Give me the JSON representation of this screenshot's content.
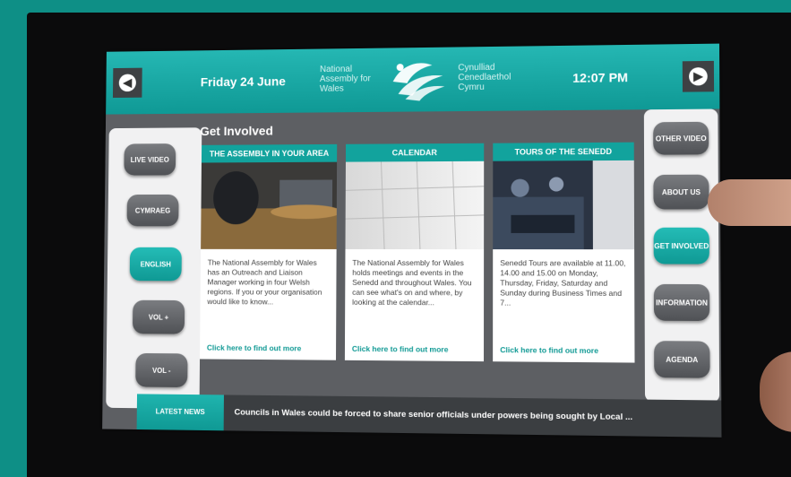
{
  "header": {
    "date": "Friday 24 June",
    "time": "12:07 PM",
    "org_en": "National Assembly for Wales",
    "org_cy": "Cynulliad Cenedlaethol Cymru"
  },
  "left_nav": [
    {
      "label": "LIVE VIDEO",
      "active": false
    },
    {
      "label": "CYMRAEG",
      "active": false
    },
    {
      "label": "ENGLISH",
      "active": true
    },
    {
      "label": "VOL +",
      "active": false
    },
    {
      "label": "VOL -",
      "active": false
    }
  ],
  "right_nav": [
    {
      "label": "OTHER VIDEO",
      "active": false
    },
    {
      "label": "ABOUT US",
      "active": false
    },
    {
      "label": "GET INVOLVED",
      "active": true
    },
    {
      "label": "INFORMATION",
      "active": false
    },
    {
      "label": "AGENDA",
      "active": false
    }
  ],
  "main": {
    "title": "Get Involved",
    "cards": [
      {
        "heading": "THE ASSEMBLY IN YOUR AREA",
        "body": "The National Assembly for Wales has an Outreach and Liaison Manager working in four Welsh regions. If you or your organisation would like to know...",
        "link": "Click here to find out more"
      },
      {
        "heading": "CALENDAR",
        "body": "The National Assembly for Wales holds meetings and events in the Senedd and throughout Wales. You can see what's on and where, by looking at the calendar...",
        "link": "Click here to find out more"
      },
      {
        "heading": "TOURS OF THE SENEDD",
        "body": "Senedd Tours are available at 11.00, 14.00 and 15.00 on Monday, Thursday, Friday, Saturday and Sunday during Business Times and 7...",
        "link": "Click here to find out more"
      }
    ]
  },
  "news": {
    "tab_label": "LATEST NEWS",
    "headline": "Councils in Wales could be forced to share senior officials under powers being sought by Local ..."
  },
  "icons": {
    "prev": "chevron-left-icon",
    "next": "chevron-right-icon"
  },
  "colors": {
    "accent": "#12a39d",
    "panel": "#5d5f63",
    "nav_button": "#5f6165"
  }
}
